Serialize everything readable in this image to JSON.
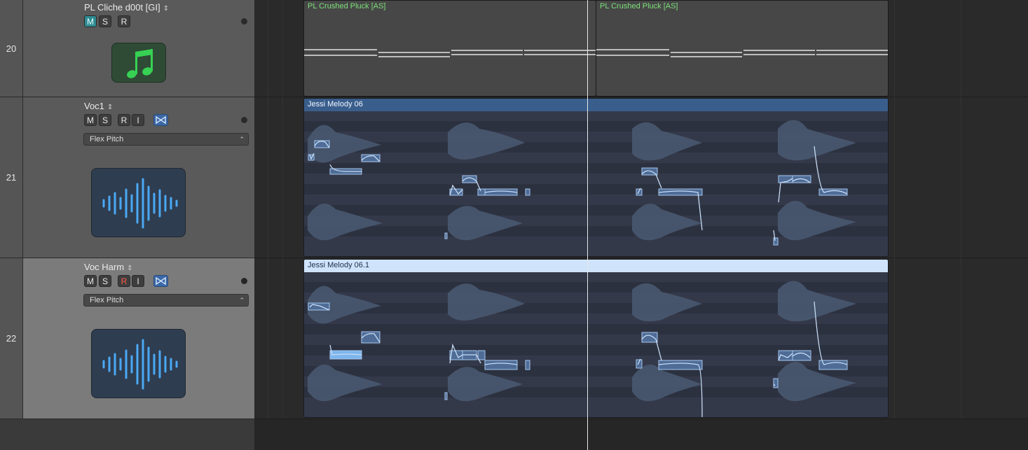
{
  "tracks": [
    {
      "number": "20",
      "name": "PL Cliche d00t [GI]",
      "buttons": [
        "M",
        "S",
        "R"
      ],
      "icon": "music-note-icon"
    },
    {
      "number": "21",
      "name": "Voc1",
      "buttons": [
        "M",
        "S",
        "R",
        "I"
      ],
      "flex_mode": "Flex Pitch",
      "icon": "waveform-icon"
    },
    {
      "number": "22",
      "name": "Voc Harm",
      "buttons": [
        "M",
        "S",
        "R",
        "I"
      ],
      "flex_mode": "Flex Pitch",
      "icon": "waveform-icon"
    }
  ],
  "regions": {
    "midi_1": "PL Crushed Pluck [AS]",
    "midi_2": "PL Crushed Pluck [AS]",
    "audio_1": "Jessi Melody 06",
    "audio_2": "Jessi Melody 06.1"
  },
  "colors": {
    "mute_active": "#2f8c92",
    "record_armed": "#ff5b4d",
    "midi_region_title": "#7de07a",
    "audio_region_header": "#3a5e8c",
    "selected_region_header": "#cfe3fb",
    "flex_button": "#3b69a8",
    "waveform": "#4a5a72",
    "pitch_curve": "#9fc6ee"
  }
}
